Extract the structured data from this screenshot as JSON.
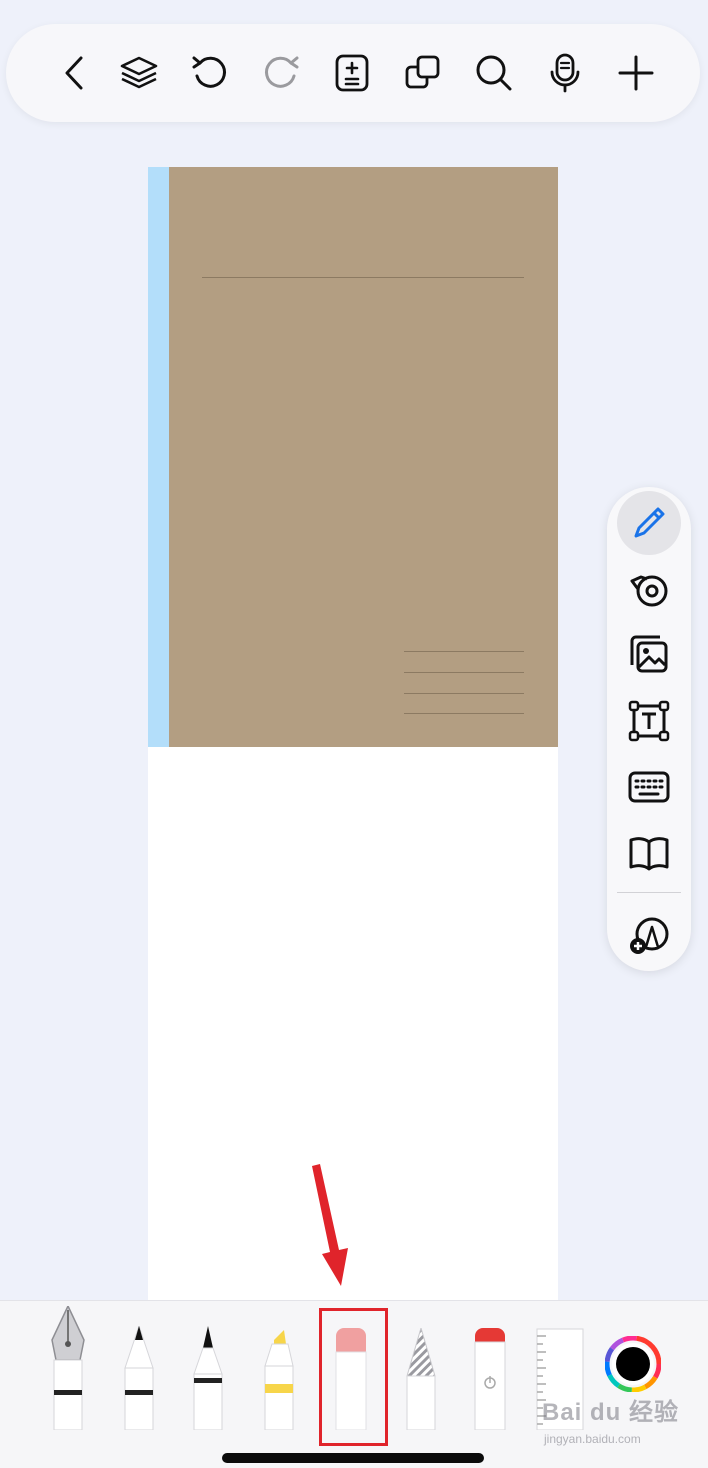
{
  "top_toolbar": {
    "buttons": [
      {
        "name": "back-button",
        "icon": "chevron-left-icon"
      },
      {
        "name": "layers-button",
        "icon": "layers-icon"
      },
      {
        "name": "undo-button",
        "icon": "undo-icon"
      },
      {
        "name": "redo-button",
        "icon": "redo-icon",
        "disabled": true
      },
      {
        "name": "page-add-button",
        "icon": "page-plus-minus-icon"
      },
      {
        "name": "duplicate-button",
        "icon": "copy-icon"
      },
      {
        "name": "search-button",
        "icon": "search-icon"
      },
      {
        "name": "voice-button",
        "icon": "microphone-icon"
      },
      {
        "name": "add-button",
        "icon": "plus-icon"
      }
    ]
  },
  "notebook": {
    "cover_color": "#b39e82",
    "spine_color": "#b3defa",
    "page_color": "#ffffff"
  },
  "side_toolbar": {
    "items": [
      {
        "name": "pen-mode",
        "icon": "pencil-icon",
        "active": true
      },
      {
        "name": "tape-mode",
        "icon": "tape-icon"
      },
      {
        "name": "image-mode",
        "icon": "image-icon"
      },
      {
        "name": "textbox-mode",
        "icon": "text-box-icon"
      },
      {
        "name": "keyboard-mode",
        "icon": "keyboard-icon"
      },
      {
        "name": "reader-mode",
        "icon": "book-icon"
      },
      {
        "name": "shapes-add",
        "icon": "shapes-add-icon"
      }
    ]
  },
  "drawing_tools": [
    {
      "name": "fountain-pen",
      "icon": "fountain-pen-icon"
    },
    {
      "name": "ballpoint-pen",
      "icon": "ballpoint-pen-icon"
    },
    {
      "name": "brush-pen",
      "icon": "brush-pen-icon"
    },
    {
      "name": "highlighter",
      "icon": "highlighter-icon",
      "accent": "#f7d54a"
    },
    {
      "name": "eraser",
      "icon": "eraser-icon",
      "accent": "#f0a0a0",
      "selected": true
    },
    {
      "name": "lasso",
      "icon": "lasso-icon"
    },
    {
      "name": "laser-pointer",
      "icon": "laser-pointer-icon",
      "accent": "#e53935"
    },
    {
      "name": "ruler",
      "icon": "ruler-icon"
    },
    {
      "name": "color-picker",
      "icon": "color-wheel-icon",
      "current_color": "#000000"
    }
  ],
  "annotation": {
    "color": "#e0242b"
  },
  "watermark": {
    "main": "Bai du 经验",
    "sub": "jingyan.baidu.com"
  }
}
